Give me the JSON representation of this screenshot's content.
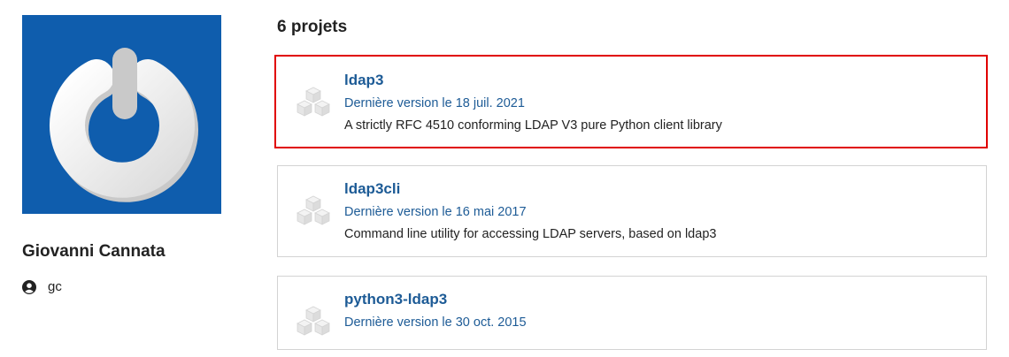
{
  "profile": {
    "name": "Giovanni Cannata",
    "username": "gc",
    "avatar_color": "#0f5dad",
    "avatar_icon": "power-logo-icon",
    "user_icon": "user-circle-icon"
  },
  "projects": {
    "count_label": "6 projets",
    "link_color": "#1d5b96",
    "highlight_color": "#e00000",
    "items": [
      {
        "name": "ldap3",
        "version": "Dernière version le 18 juil. 2021",
        "description": "A strictly RFC 4510 conforming LDAP V3 pure Python client library",
        "icon": "package-cubes-icon"
      },
      {
        "name": "ldap3cli",
        "version": "Dernière version le 16 mai 2017",
        "description": "Command line utility for accessing LDAP servers, based on ldap3",
        "icon": "package-cubes-icon"
      },
      {
        "name": "python3-ldap3",
        "version": "Dernière version le 30 oct. 2015",
        "description": "",
        "icon": "package-cubes-icon"
      }
    ]
  }
}
